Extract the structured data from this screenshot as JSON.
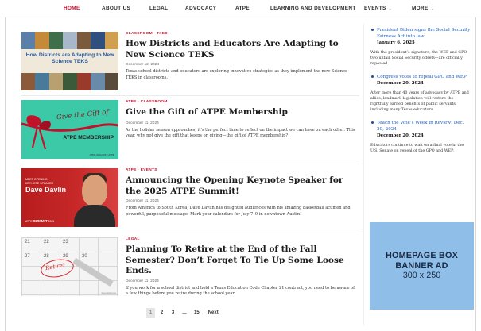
{
  "nav": {
    "items": [
      {
        "label": "HOME",
        "active": true
      },
      {
        "label": "ABOUT US"
      },
      {
        "label": "LEGAL"
      },
      {
        "label": "ADVOCACY"
      },
      {
        "label": "ATPE"
      },
      {
        "label": "LEARNING AND DEVELOPMENT"
      },
      {
        "label": "EVENTS",
        "dropdown": true
      },
      {
        "label": "MORE",
        "dropdown": true
      }
    ]
  },
  "articles": [
    {
      "categories": "CLASSROOM · TXED",
      "title": "How Districts and Educators Are Adapting to New Science TEKS",
      "date": "December 12, 2024",
      "excerpt": "Texas school districts and educators are exploring innovative strategies as they implement the new Science TEKS in classrooms.",
      "thumb_caption": "How Districts are Adapting to New Science TEKS"
    },
    {
      "categories": "ATPE · CLASSROOM",
      "title": "Give the Gift of ATPE Membership",
      "date": "December 11, 2024",
      "excerpt": "As the holiday season approaches, it’s the perfect time to reflect on the impact we can have on each other. This year, why not give the gift that keeps on giving—the gift of ATPE membership?",
      "thumb_script": "Give the Gift of",
      "thumb_title": "ATPE MEMBERSHIP",
      "thumb_small": "ATPE.ORG/GIFT-ATPE"
    },
    {
      "categories": "ATPE · EVENTS",
      "title": "Announcing the Opening Keynote Speaker for the 2025 ATPE Summit!",
      "date": "December 11, 2024",
      "excerpt": "From America to South Korea, Dave Davlin has delighted audiences with his amazing basketball acumen and powerful, purposeful message. Mark your calendars for July 7–9 in downtown Austin!",
      "thumb_meet": "MEET OPENING",
      "thumb_role": "KEYNOTE SPEAKER",
      "thumb_name": "Dave Davlin",
      "thumb_atpe": "ATPE",
      "thumb_summit": "SUMMIT",
      "thumb_year": "2025"
    },
    {
      "categories": "LEGAL",
      "title": "Planning To Retire at the End of the Fall Semester? Don’t Forget To Tie Up Some Loose Ends.",
      "date": "December 11, 2024",
      "excerpt": "If you work for a school district and hold a Texas Education Code Chapter 21 contract, you need to be aware of a few things before you retire during the school year.",
      "thumb_word": "Retire!",
      "thumb_numbers": [
        "21",
        "22",
        "23",
        "27",
        "28",
        "29",
        "30"
      ],
      "thumb_credit": "depositphotos"
    }
  ],
  "pagination": {
    "pages": [
      "1",
      "2",
      "3",
      "…",
      "15"
    ],
    "current": "1",
    "next_label": "Next"
  },
  "sidebar": {
    "news": [
      {
        "link": "President Biden signs the Social Security Fairness Act into law",
        "date": "January 6, 2025",
        "text": "With the president’s signature, the WEP and GPO—two unfair Social Security offsets—are officially repealed."
      },
      {
        "link": "Congress votes to repeal GPO and WEP",
        "date": "December 20, 2024",
        "text": "After more than 40 years of advocacy by ATPE and allies, landmark legislation will restore the rightfully earned benefits of public servants, including many Texas educators."
      },
      {
        "link": "Teach the Vote’s Week in Review: Dec. 20, 2024",
        "date": "December 20, 2024",
        "text": "Educators continue to wait on a final vote in the U.S. Senate on repeal of the GPO and WEP."
      }
    ],
    "ad": {
      "line1": "HOMEPAGE BOX",
      "line2": "BANNER AD",
      "line3": "300 x 250"
    }
  },
  "colors": {
    "accent_red": "#c8102e",
    "link_blue": "#1f5fbf",
    "ad_blue": "#8fbfe8",
    "gift_teal": "#3cc9a8"
  }
}
